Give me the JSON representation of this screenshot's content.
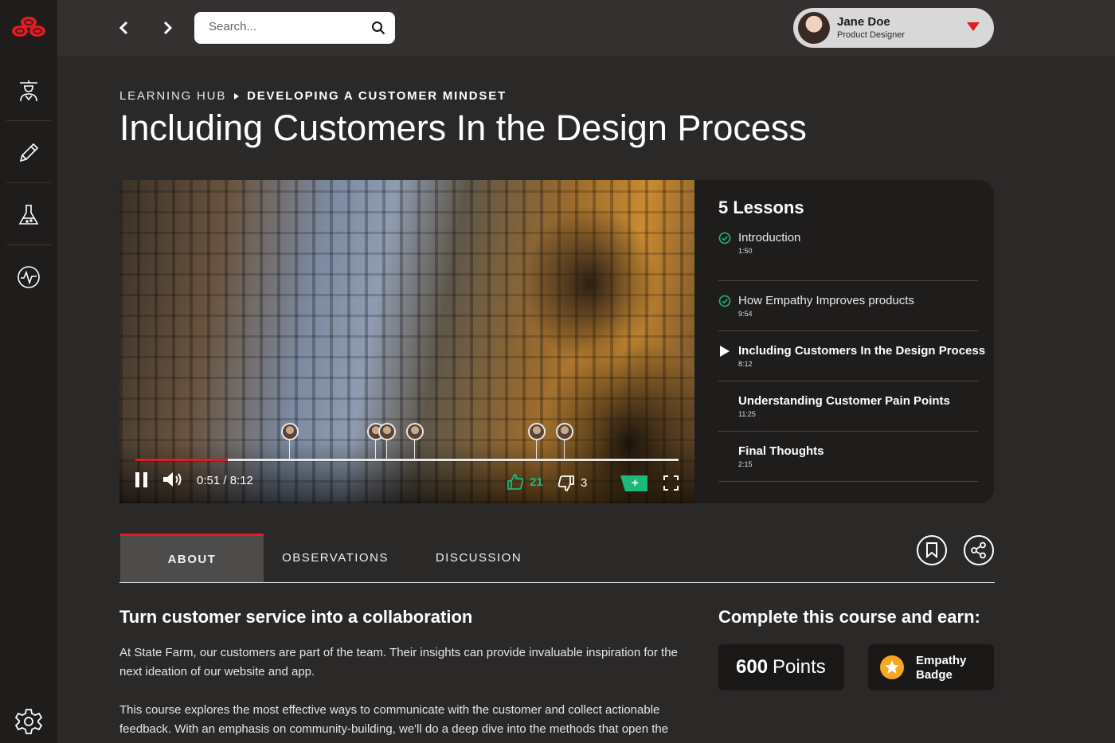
{
  "search": {
    "placeholder": "Search..."
  },
  "user": {
    "name": "Jane Doe",
    "role": "Product Designer"
  },
  "breadcrumb": {
    "parent": "LEARNING HUB",
    "current": "DEVELOPING A CUSTOMER MINDSET"
  },
  "page_title": "Including Customers In the Design Process",
  "player": {
    "time": "0:51 / 8:12",
    "progress": 0.17,
    "likes": "21",
    "dislikes": "3",
    "add_label": "+"
  },
  "lessons": {
    "title": "5 Lessons",
    "items": [
      {
        "name": "Introduction",
        "duration": "1:50",
        "status": "complete"
      },
      {
        "name": "How Empathy Improves products",
        "duration": "9:54",
        "status": "complete"
      },
      {
        "name": "Including Customers In the Design Process",
        "duration": "8:12",
        "status": "playing"
      },
      {
        "name": "Understanding Customer Pain Points",
        "duration": "11:25",
        "status": "upcoming"
      },
      {
        "name": "Final Thoughts",
        "duration": "2:15",
        "status": "upcoming"
      }
    ]
  },
  "tabs": [
    {
      "label": "ABOUT",
      "active": true
    },
    {
      "label": "OBSERVATIONS",
      "active": false
    },
    {
      "label": "DISCUSSION",
      "active": false
    }
  ],
  "about": {
    "title": "Turn customer service into a collaboration",
    "p1": "At State Farm, our customers are part of the team. Their insights can provide invaluable inspiration for the next ideation of our website and app.",
    "p2": "This course explores the most effective ways to communicate with the customer and collect actionable feedback. With an emphasis on community-building, we'll do a deep dive into the methods that open the"
  },
  "earn": {
    "title": "Complete this course and earn:",
    "points_value": "600",
    "points_label": "Points",
    "badge_label": "Empathy Badge"
  },
  "colors": {
    "accent_red": "#e51b23",
    "accent_green": "#1cb87c",
    "badge_gold": "#f5a623"
  },
  "icons": [
    "state-farm-logo",
    "teacher-icon",
    "pencil-icon",
    "flask-icon",
    "pulse-icon",
    "gear-icon",
    "chevron-left-icon",
    "chevron-right-icon",
    "search-icon",
    "caret-down-icon",
    "pause-icon",
    "volume-icon",
    "thumbs-up-icon",
    "thumbs-down-icon",
    "fullscreen-icon",
    "bookmark-icon",
    "share-icon",
    "star-badge-icon",
    "check-circle-icon",
    "play-icon"
  ]
}
